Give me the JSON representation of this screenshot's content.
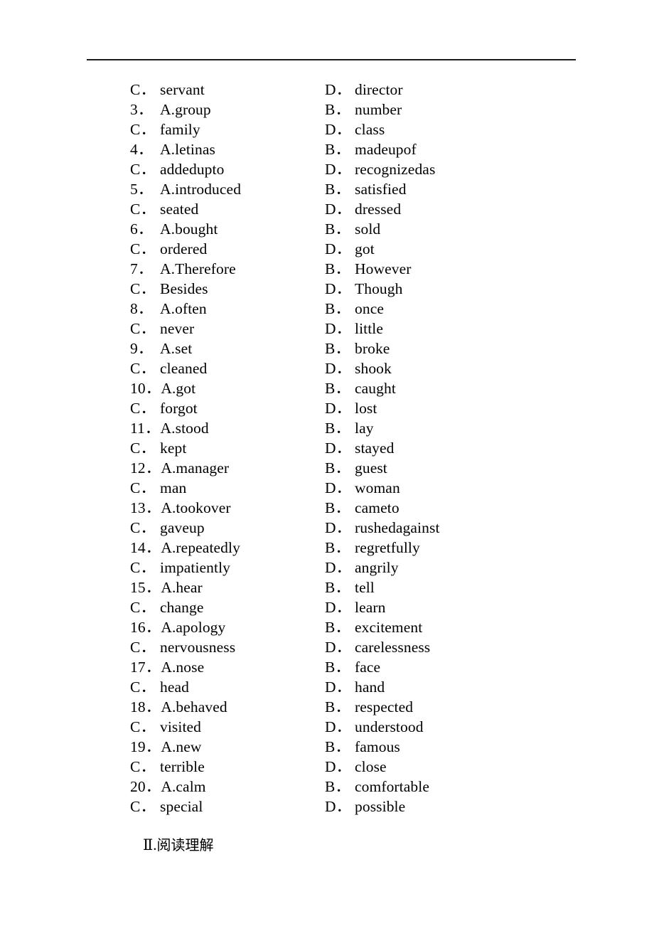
{
  "document": {
    "type": "exam-worksheet",
    "rule_visible": true,
    "text_color": "#000000",
    "background_color": "#ffffff"
  },
  "rows": [
    {
      "left_marker": "C．",
      "left_text": "servant",
      "right_marker": "D．",
      "right_text": "director"
    },
    {
      "left_marker": "3．",
      "left_text": "A.group",
      "right_marker": "B．",
      "right_text": "number"
    },
    {
      "left_marker": "C．",
      "left_text": "family",
      "right_marker": "D．",
      "right_text": "class"
    },
    {
      "left_marker": "4．",
      "left_text": "A.letinas",
      "right_marker": "B．",
      "right_text": "madeupof"
    },
    {
      "left_marker": "C．",
      "left_text": "addedupto",
      "right_marker": "D．",
      "right_text": "recognizedas"
    },
    {
      "left_marker": "5．",
      "left_text": "A.introduced",
      "right_marker": "B．",
      "right_text": "satisfied"
    },
    {
      "left_marker": "C．",
      "left_text": "seated",
      "right_marker": "D．",
      "right_text": "dressed"
    },
    {
      "left_marker": "6．",
      "left_text": "A.bought",
      "right_marker": "B．",
      "right_text": "sold"
    },
    {
      "left_marker": "C．",
      "left_text": "ordered",
      "right_marker": "D．",
      "right_text": "got"
    },
    {
      "left_marker": "7．",
      "left_text": "A.Therefore",
      "right_marker": "B．",
      "right_text": "However"
    },
    {
      "left_marker": "C．",
      "left_text": "Besides",
      "right_marker": "D．",
      "right_text": "Though"
    },
    {
      "left_marker": "8．",
      "left_text": "A.often",
      "right_marker": "B．",
      "right_text": "once"
    },
    {
      "left_marker": "C．",
      "left_text": "never",
      "right_marker": "D．",
      "right_text": "little"
    },
    {
      "left_marker": "9．",
      "left_text": "A.set",
      "right_marker": "B．",
      "right_text": "broke"
    },
    {
      "left_marker": "C．",
      "left_text": "cleaned",
      "right_marker": "D．",
      "right_text": "shook"
    },
    {
      "left_marker": "10．",
      "left_text": "A.got",
      "right_marker": "B．",
      "right_text": "caught"
    },
    {
      "left_marker": "C．",
      "left_text": "forgot",
      "right_marker": "D．",
      "right_text": "lost"
    },
    {
      "left_marker": "11．",
      "left_text": "A.stood",
      "right_marker": "B．",
      "right_text": "lay"
    },
    {
      "left_marker": "C．",
      "left_text": "kept",
      "right_marker": "D．",
      "right_text": "stayed"
    },
    {
      "left_marker": "12．",
      "left_text": "A.manager",
      "right_marker": "B．",
      "right_text": "guest"
    },
    {
      "left_marker": "C．",
      "left_text": "man",
      "right_marker": "D．",
      "right_text": "woman"
    },
    {
      "left_marker": "13．",
      "left_text": "A.tookover",
      "right_marker": "B．",
      "right_text": "cameto"
    },
    {
      "left_marker": "C．",
      "left_text": "gaveup",
      "right_marker": "D．",
      "right_text": "rushedagainst"
    },
    {
      "left_marker": "14．",
      "left_text": "A.repeatedly",
      "right_marker": "B．",
      "right_text": "regretfully"
    },
    {
      "left_marker": "C．",
      "left_text": "impatiently",
      "right_marker": "D．",
      "right_text": "angrily"
    },
    {
      "left_marker": "15．",
      "left_text": "A.hear",
      "right_marker": "B．",
      "right_text": "tell"
    },
    {
      "left_marker": "C．",
      "left_text": "change",
      "right_marker": "D．",
      "right_text": "learn"
    },
    {
      "left_marker": "16．",
      "left_text": "A.apology",
      "right_marker": "B．",
      "right_text": "excitement"
    },
    {
      "left_marker": "C．",
      "left_text": "nervousness",
      "right_marker": "D．",
      "right_text": "carelessness"
    },
    {
      "left_marker": "17．",
      "left_text": "A.nose",
      "right_marker": "B．",
      "right_text": "face"
    },
    {
      "left_marker": "C．",
      "left_text": "head",
      "right_marker": "D．",
      "right_text": "hand"
    },
    {
      "left_marker": "18．",
      "left_text": "A.behaved",
      "right_marker": "B．",
      "right_text": "respected"
    },
    {
      "left_marker": "C．",
      "left_text": "visited",
      "right_marker": "D．",
      "right_text": "understood"
    },
    {
      "left_marker": "19．",
      "left_text": "A.new",
      "right_marker": "B．",
      "right_text": "famous"
    },
    {
      "left_marker": "C．",
      "left_text": "terrible",
      "right_marker": "D．",
      "right_text": "close"
    },
    {
      "left_marker": "20．",
      "left_text": "A.calm",
      "right_marker": "B．",
      "right_text": "comfortable"
    },
    {
      "left_marker": "C．",
      "left_text": "special",
      "right_marker": "D．",
      "right_text": "possible"
    }
  ],
  "section_heading": {
    "numeral": "Ⅱ",
    "separator": ".",
    "title": "阅读理解"
  }
}
